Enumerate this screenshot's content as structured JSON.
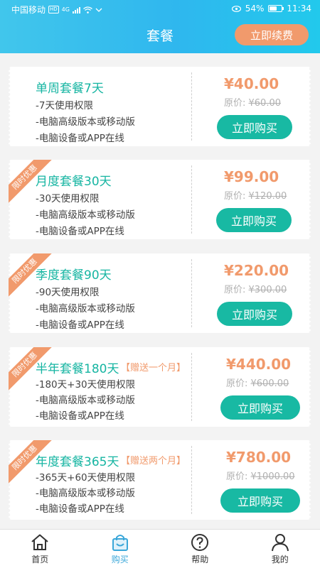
{
  "status_bar": {
    "carrier": "中国移动",
    "hd": "HD",
    "net": "4G",
    "battery": "54%",
    "time": "11:34"
  },
  "header": {
    "title": "套餐",
    "renew_button": "立即续费"
  },
  "plans": [
    {
      "name": "单周套餐7天",
      "gift": "",
      "ribbon": "",
      "features": [
        "-7天使用权限",
        "-电脑高级版本或移动版",
        "-电脑设备或APP在线"
      ],
      "price": "¥40.00",
      "original_label": "原价: ",
      "original_price": "¥60.00",
      "buy_label": "立即购买"
    },
    {
      "name": "月度套餐30天",
      "gift": "",
      "ribbon": "限时优惠",
      "features": [
        "-30天使用权限",
        "-电脑高级版本或移动版",
        "-电脑设备或APP在线"
      ],
      "price": "¥99.00",
      "original_label": "原价: ",
      "original_price": "¥120.00",
      "buy_label": "立即购买"
    },
    {
      "name": "季度套餐90天",
      "gift": "",
      "ribbon": "限时优惠",
      "features": [
        "-90天使用权限",
        "-电脑高级版本或移动版",
        "-电脑设备或APP在线"
      ],
      "price": "¥220.00",
      "original_label": "原价: ",
      "original_price": "¥300.00",
      "buy_label": "立即购买"
    },
    {
      "name": "半年套餐180天",
      "gift": "【赠送一个月】",
      "ribbon": "限时优惠",
      "features": [
        "-180天+30天使用权限",
        "-电脑高级版本或移动版",
        "-电脑设备或APP在线"
      ],
      "price": "¥440.00",
      "original_label": "原价: ",
      "original_price": "¥600.00",
      "buy_label": "立即购买"
    },
    {
      "name": "年度套餐365天",
      "gift": "【赠送两个月】",
      "ribbon": "限时优惠",
      "features": [
        "-365天+60天使用权限",
        "-电脑高级版本或移动版",
        "-电脑设备或APP在线"
      ],
      "price": "¥780.00",
      "original_label": "原价: ",
      "original_price": "¥1000.00",
      "buy_label": "立即购买"
    }
  ],
  "nav": [
    {
      "label": "首页",
      "icon": "home-icon",
      "active": false
    },
    {
      "label": "购买",
      "icon": "shopping-bag-icon",
      "active": true
    },
    {
      "label": "帮助",
      "icon": "help-icon",
      "active": false
    },
    {
      "label": "我的",
      "icon": "user-icon",
      "active": false
    }
  ],
  "colors": {
    "accent": "#18b9a3",
    "price": "#f19a6c",
    "header": "#2fb7ee",
    "nav_active": "#3aa7d9"
  }
}
